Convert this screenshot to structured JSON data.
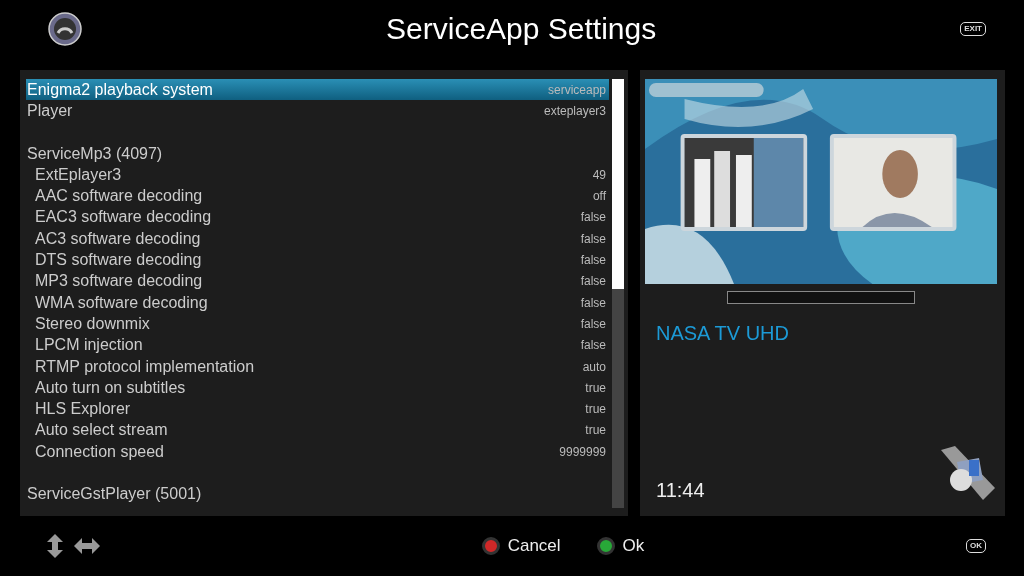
{
  "header": {
    "title": "ServiceApp Settings",
    "exit_key": "EXIT"
  },
  "settings": [
    {
      "kind": "section",
      "label": "Enigma2 playback system",
      "value": "serviceapp",
      "selected": true
    },
    {
      "kind": "section",
      "label": "Player",
      "value": "exteplayer3",
      "selected": false
    },
    {
      "kind": "spacer"
    },
    {
      "kind": "section",
      "label": "ServiceMp3 (4097)",
      "selected": false
    },
    {
      "kind": "option",
      "label": "ExtEplayer3",
      "value": "49",
      "selected": false
    },
    {
      "kind": "option",
      "label": "AAC software decoding",
      "value": "off",
      "selected": false
    },
    {
      "kind": "option",
      "label": "EAC3 software decoding",
      "value": "false",
      "selected": false
    },
    {
      "kind": "option",
      "label": "AC3 software decoding",
      "value": "false",
      "selected": false
    },
    {
      "kind": "option",
      "label": "DTS software decoding",
      "value": "false",
      "selected": false
    },
    {
      "kind": "option",
      "label": "MP3 software decoding",
      "value": "false",
      "selected": false
    },
    {
      "kind": "option",
      "label": "WMA software decoding",
      "value": "false",
      "selected": false
    },
    {
      "kind": "option",
      "label": "Stereo downmix",
      "value": "false",
      "selected": false
    },
    {
      "kind": "option",
      "label": "LPCM injection",
      "value": "false",
      "selected": false
    },
    {
      "kind": "option",
      "label": "RTMP protocol implementation",
      "value": "auto",
      "selected": false
    },
    {
      "kind": "option",
      "label": "Auto turn on subtitles",
      "value": "true",
      "selected": false
    },
    {
      "kind": "option",
      "label": "HLS Explorer",
      "value": "true",
      "selected": false
    },
    {
      "kind": "option",
      "label": "Auto select stream",
      "value": "true",
      "selected": false
    },
    {
      "kind": "option",
      "label": "Connection speed",
      "value": "9999999",
      "selected": false
    },
    {
      "kind": "spacer"
    },
    {
      "kind": "section",
      "label": "ServiceGstPlayer (5001)",
      "selected": false
    }
  ],
  "preview": {
    "progress": {
      "level": 0
    },
    "channel": "NASA TV UHD",
    "time": "11:44"
  },
  "footer": {
    "buttons": [
      {
        "label": "Cancel",
        "color": "#d02828"
      },
      {
        "label": "Ok",
        "color": "#28a838"
      }
    ],
    "ok_key": "OK"
  }
}
